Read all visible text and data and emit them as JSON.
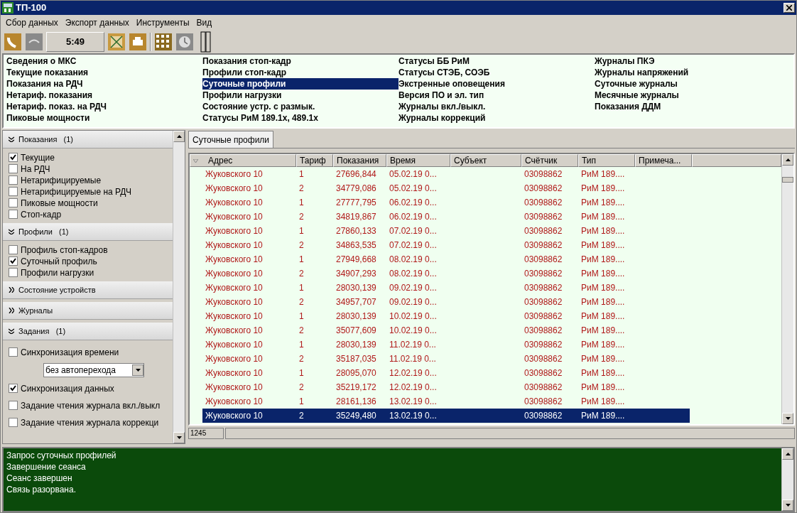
{
  "window": {
    "title": "ТП-100"
  },
  "menu": [
    "Сбор данных",
    "Экспорт данных",
    "Инструменты",
    "Вид"
  ],
  "toolbar": {
    "timer": "5:49"
  },
  "reports": [
    [
      {
        "label": "Сведения о МКС",
        "selected": false
      },
      {
        "label": "Текущие показания",
        "selected": false
      },
      {
        "label": "Показания на РДЧ",
        "selected": false
      },
      {
        "label": "Нетариф. показания",
        "selected": false
      },
      {
        "label": "Нетариф. показ. на РДЧ",
        "selected": false
      },
      {
        "label": "Пиковые мощности",
        "selected": false
      }
    ],
    [
      {
        "label": "Показания стоп-кадр",
        "selected": false
      },
      {
        "label": "Профили стоп-кадр",
        "selected": false
      },
      {
        "label": "Суточные профили",
        "selected": true
      },
      {
        "label": "Профили нагрузки",
        "selected": false
      },
      {
        "label": "Состояние устр. с размык.",
        "selected": false
      },
      {
        "label": "Статусы РиМ 189.1х, 489.1х",
        "selected": false
      }
    ],
    [
      {
        "label": "Статусы ББ РиМ",
        "selected": false
      },
      {
        "label": "Статусы СТЭБ, СОЭБ",
        "selected": false
      },
      {
        "label": "Экстренные оповещения",
        "selected": false
      },
      {
        "label": "Версия ПО и эл. тип",
        "selected": false
      },
      {
        "label": "Журналы вкл./выкл.",
        "selected": false
      },
      {
        "label": "Журналы коррекций",
        "selected": false
      }
    ],
    [
      {
        "label": "Журналы ПКЭ",
        "selected": false
      },
      {
        "label": "Журналы напряжений",
        "selected": false
      },
      {
        "label": "Суточные журналы",
        "selected": false
      },
      {
        "label": "Месячные журналы",
        "selected": false
      },
      {
        "label": "Показания ДДМ",
        "selected": false
      }
    ]
  ],
  "sidebar": [
    {
      "title": "Показания",
      "count": "(1)",
      "expanded": true,
      "items": [
        {
          "kind": "checkbox",
          "label": "Текущие",
          "checked": true
        },
        {
          "kind": "checkbox",
          "label": "На РДЧ",
          "checked": false
        },
        {
          "kind": "checkbox",
          "label": "Нетарифицируемые",
          "checked": false
        },
        {
          "kind": "checkbox",
          "label": "Нетарифицируемые на РДЧ",
          "checked": false
        },
        {
          "kind": "checkbox",
          "label": "Пиковые мощности",
          "checked": false
        },
        {
          "kind": "checkbox",
          "label": "Стоп-кадр",
          "checked": false
        }
      ]
    },
    {
      "title": "Профили",
      "count": "(1)",
      "expanded": true,
      "items": [
        {
          "kind": "checkbox",
          "label": "Профиль стоп-кадров",
          "checked": false
        },
        {
          "kind": "checkbox",
          "label": "Суточный профиль",
          "checked": true
        },
        {
          "kind": "checkbox",
          "label": "Профили нагрузки",
          "checked": false
        }
      ]
    },
    {
      "title": "Состояние устройств",
      "expanded": false
    },
    {
      "title": "Журналы",
      "expanded": false
    },
    {
      "title": "Задания",
      "count": "(1)",
      "expanded": true,
      "items": [
        {
          "kind": "checkbox",
          "label": "Синхронизация времени",
          "checked": false
        },
        {
          "kind": "dropdown",
          "value": "без автоперехода"
        },
        {
          "kind": "checkbox",
          "label": "Синхронизация данных",
          "checked": true
        },
        {
          "kind": "checkbox",
          "label": "Задание чтения журнала вкл./выкл",
          "checked": false
        },
        {
          "kind": "checkbox",
          "label": "Задание чтения журнала коррекци",
          "checked": false
        }
      ]
    }
  ],
  "tab": {
    "label": "Суточные профили",
    "selected": true
  },
  "table": {
    "columns": [
      {
        "label": "Адрес",
        "sorted": true
      },
      {
        "label": "Тариф",
        "sorted": false
      },
      {
        "label": "Показания",
        "sorted": false
      },
      {
        "label": "Время",
        "sorted": false
      },
      {
        "label": "Субъект",
        "sorted": false
      },
      {
        "label": "Счётчик",
        "sorted": false
      },
      {
        "label": "Тип",
        "sorted": false
      },
      {
        "label": "Примеча...",
        "sorted": false
      }
    ],
    "rows": [
      {
        "cells": [
          "Жуковского 10",
          "1",
          "27696,844",
          "05.02.19 0...",
          "",
          "03098862",
          "РиМ 189....",
          ""
        ],
        "selected": false
      },
      {
        "cells": [
          "Жуковского 10",
          "2",
          "34779,086",
          "05.02.19 0...",
          "",
          "03098862",
          "РиМ 189....",
          ""
        ],
        "selected": false
      },
      {
        "cells": [
          "Жуковского 10",
          "1",
          "27777,795",
          "06.02.19 0...",
          "",
          "03098862",
          "РиМ 189....",
          ""
        ],
        "selected": false
      },
      {
        "cells": [
          "Жуковского 10",
          "2",
          "34819,867",
          "06.02.19 0...",
          "",
          "03098862",
          "РиМ 189....",
          ""
        ],
        "selected": false
      },
      {
        "cells": [
          "Жуковского 10",
          "1",
          "27860,133",
          "07.02.19 0...",
          "",
          "03098862",
          "РиМ 189....",
          ""
        ],
        "selected": false
      },
      {
        "cells": [
          "Жуковского 10",
          "2",
          "34863,535",
          "07.02.19 0...",
          "",
          "03098862",
          "РиМ 189....",
          ""
        ],
        "selected": false
      },
      {
        "cells": [
          "Жуковского 10",
          "1",
          "27949,668",
          "08.02.19 0...",
          "",
          "03098862",
          "РиМ 189....",
          ""
        ],
        "selected": false
      },
      {
        "cells": [
          "Жуковского 10",
          "2",
          "34907,293",
          "08.02.19 0...",
          "",
          "03098862",
          "РиМ 189....",
          ""
        ],
        "selected": false
      },
      {
        "cells": [
          "Жуковского 10",
          "1",
          "28030,139",
          "09.02.19 0...",
          "",
          "03098862",
          "РиМ 189....",
          ""
        ],
        "selected": false
      },
      {
        "cells": [
          "Жуковского 10",
          "2",
          "34957,707",
          "09.02.19 0...",
          "",
          "03098862",
          "РиМ 189....",
          ""
        ],
        "selected": false
      },
      {
        "cells": [
          "Жуковского 10",
          "1",
          "28030,139",
          "10.02.19 0...",
          "",
          "03098862",
          "РиМ 189....",
          ""
        ],
        "selected": false
      },
      {
        "cells": [
          "Жуковского 10",
          "2",
          "35077,609",
          "10.02.19 0...",
          "",
          "03098862",
          "РиМ 189....",
          ""
        ],
        "selected": false
      },
      {
        "cells": [
          "Жуковского 10",
          "1",
          "28030,139",
          "11.02.19 0...",
          "",
          "03098862",
          "РиМ 189....",
          ""
        ],
        "selected": false
      },
      {
        "cells": [
          "Жуковского 10",
          "2",
          "35187,035",
          "11.02.19 0...",
          "",
          "03098862",
          "РиМ 189....",
          ""
        ],
        "selected": false
      },
      {
        "cells": [
          "Жуковского 10",
          "1",
          "28095,070",
          "12.02.19 0...",
          "",
          "03098862",
          "РиМ 189....",
          ""
        ],
        "selected": false
      },
      {
        "cells": [
          "Жуковского 10",
          "2",
          "35219,172",
          "12.02.19 0...",
          "",
          "03098862",
          "РиМ 189....",
          ""
        ],
        "selected": false
      },
      {
        "cells": [
          "Жуковского 10",
          "1",
          "28161,136",
          "13.02.19 0...",
          "",
          "03098862",
          "РиМ 189....",
          ""
        ],
        "selected": false
      },
      {
        "cells": [
          "Жуковского 10",
          "2",
          "35249,480",
          "13.02.19 0...",
          "",
          "03098862",
          "РиМ 189....",
          ""
        ],
        "selected": true
      }
    ]
  },
  "status": {
    "count": "1245"
  },
  "log": [
    "Запрос суточных профилей",
    "Завершение сеанса",
    "Сеанс завершен",
    "Связь разорвана."
  ]
}
